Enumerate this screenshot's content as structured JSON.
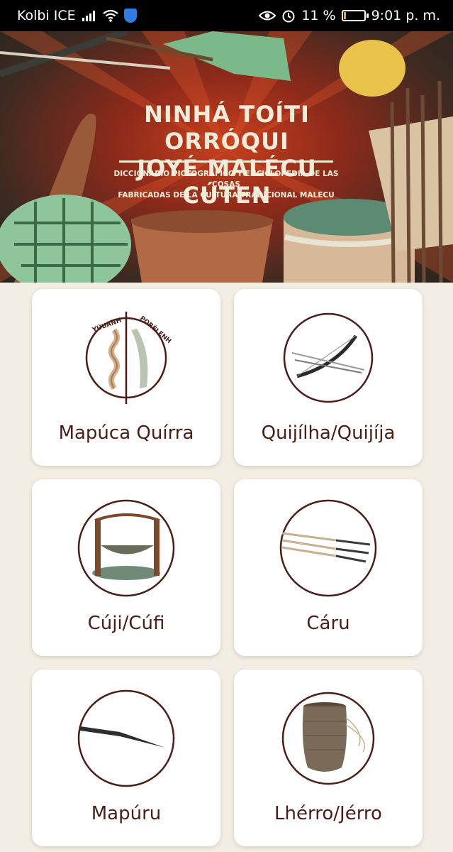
{
  "status_bar": {
    "carrier": "Kolbi ICE",
    "battery_percent": "11 %",
    "battery_level": 0.11,
    "time": "9:01 p. m."
  },
  "banner": {
    "title_line1": "NINHÁ TOÍTI ORRÓQUI",
    "title_line2": "JOYÉ MALÉCU CÚTEN",
    "subtitle_line1": "DICCIONARIO PICTOGRÁFICO Y ENCICLOPEDIA DE LAS COSAS",
    "subtitle_line2": "FABRICADAS DE LA CULTURA TRADICIONAL MALECU"
  },
  "items": [
    {
      "label": "Mapúca Quírra",
      "icon": "rope-fiber-icon",
      "icon_text_left": "YÚUANH",
      "icon_text_right": "PORÉLENH"
    },
    {
      "label": "Quijílha/Quijíja",
      "icon": "bow-arrow-icon"
    },
    {
      "label": "Cúji/Cúfi",
      "icon": "hammock-frame-icon"
    },
    {
      "label": "Cáru",
      "icon": "arrows-icon"
    },
    {
      "label": "Mapúru",
      "icon": "spear-point-icon"
    },
    {
      "label": "Lhérro/Jérro",
      "icon": "woven-bag-icon"
    }
  ],
  "colors": {
    "label": "#4a1e18",
    "circle_stroke": "#4a1e18",
    "background": "#f3eee3"
  }
}
